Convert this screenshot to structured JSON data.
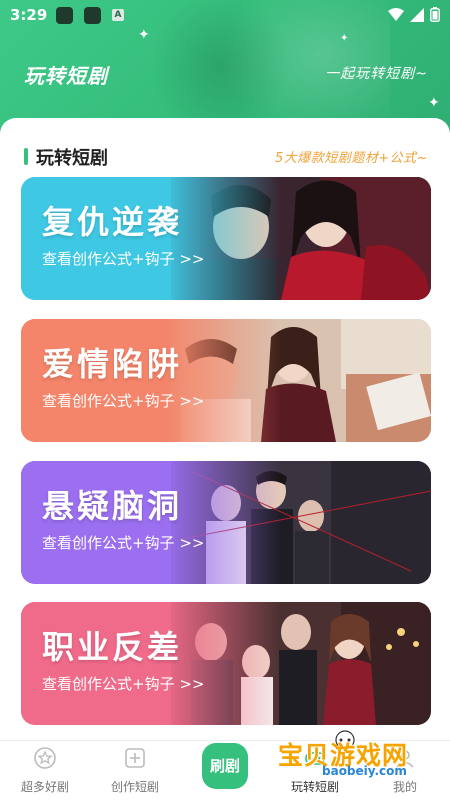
{
  "status_bar": {
    "time": "3:29",
    "badge": "A"
  },
  "hero": {
    "title": "玩转短剧",
    "slogan": "一起玩转短剧~"
  },
  "section": {
    "title": "玩转短剧",
    "subtitle": "5大爆款短剧题材+公式~"
  },
  "cards": [
    {
      "title": "复仇逆袭",
      "link": "查看创作公式+钩子 >>",
      "color_start": "#3fc6e6",
      "color_end": "#4ea8e8"
    },
    {
      "title": "爱情陷阱",
      "link": "查看创作公式+钩子 >>",
      "color_start": "#f5866a",
      "color_end": "#f7a38d"
    },
    {
      "title": "悬疑脑洞",
      "link": "查看创作公式+钩子 >>",
      "color_start": "#9a6ff0",
      "color_end": "#b07ee8"
    },
    {
      "title": "职业反差",
      "link": "查看创作公式+钩子 >>",
      "color_start": "#f06a8a",
      "color_end": "#f58aa2"
    }
  ],
  "tabs": [
    {
      "label": "超多好剧",
      "icon": "star-badge-icon"
    },
    {
      "label": "创作短剧",
      "icon": "add-square-icon"
    },
    {
      "label": "刷剧",
      "icon": "play-center"
    },
    {
      "label": "玩转短剧",
      "icon": "game-icon"
    },
    {
      "label": "我的",
      "icon": "user-icon"
    }
  ],
  "watermark": {
    "text": "宝贝游戏网",
    "url": "baobeiy.com"
  },
  "accent": "#35c07e"
}
